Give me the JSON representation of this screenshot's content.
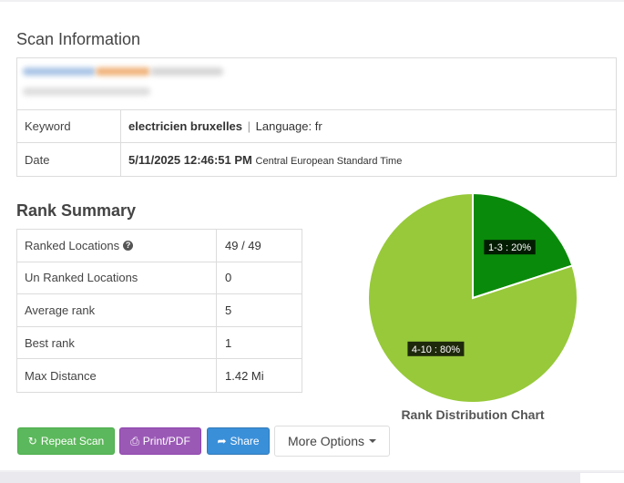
{
  "scan": {
    "title": "Scan Information",
    "keyword_label": "Keyword",
    "keyword_value": "electricien bruxelles",
    "separator": "|",
    "language_text": "Language: fr",
    "date_label": "Date",
    "date_value": "5/11/2025 12:46:51 PM",
    "timezone": "Central European Standard Time"
  },
  "rank_summary": {
    "title": "Rank Summary",
    "rows": [
      {
        "label": "Ranked Locations",
        "value": "49 / 49"
      },
      {
        "label": "Un Ranked Locations",
        "value": "0"
      },
      {
        "label": "Average rank",
        "value": "5"
      },
      {
        "label": "Best rank",
        "value": "1"
      },
      {
        "label": "Max Distance",
        "value": "1.42 Mi"
      }
    ],
    "help_icon": "?"
  },
  "chart_data": {
    "type": "pie",
    "title": "Rank Distribution Chart",
    "slices": [
      {
        "label": "1-3 : 20%",
        "value": 20,
        "color": "#0a8a0a"
      },
      {
        "label": "4-10 : 80%",
        "value": 80,
        "color": "#97c93a"
      }
    ]
  },
  "buttons": {
    "repeat": "Repeat Scan",
    "print": "Print/PDF",
    "share": "Share",
    "more": "More Options"
  },
  "icons": {
    "repeat": "refresh-icon",
    "print": "print-icon",
    "share": "share-icon"
  }
}
